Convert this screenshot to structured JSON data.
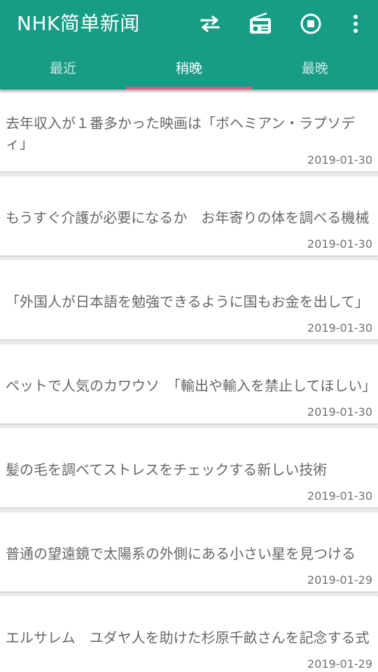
{
  "app_title": "NHK简单新闻",
  "toolbar": {
    "icons": [
      "swap-icon",
      "radio-icon",
      "stop-circle-icon",
      "more-vert-icon"
    ]
  },
  "tabs": [
    {
      "label": "最近",
      "active": false
    },
    {
      "label": "稍晚",
      "active": true
    },
    {
      "label": "最晚",
      "active": false
    }
  ],
  "colors": {
    "appbar": "#179c86",
    "indicator": "#e9557f",
    "background": "#ebebeb",
    "card": "#ffffff",
    "text": "#666666"
  },
  "articles": [
    {
      "title": "去年収入が１番多かった映画は「ボヘミアン・ラプソディ」",
      "date": "2019-01-30"
    },
    {
      "title": "もうすぐ介護が必要になるか　お年寄りの体を調べる機械",
      "date": "2019-01-30"
    },
    {
      "title": "「外国人が日本語を勉強できるように国もお金を出して」",
      "date": "2019-01-30"
    },
    {
      "title": "ペットで人気のカワウソ　「輸出や輸入を禁止してほしい」",
      "date": "2019-01-30"
    },
    {
      "title": "髪の毛を調べてストレスをチェックする新しい技術",
      "date": "2019-01-30"
    },
    {
      "title": "普通の望遠鏡で太陽系の外側にある小さい星を見つける",
      "date": "2019-01-29"
    },
    {
      "title": "エルサレム　ユダヤ人を助けた杉原千畝さんを記念する式",
      "date": "2019-01-29"
    }
  ]
}
